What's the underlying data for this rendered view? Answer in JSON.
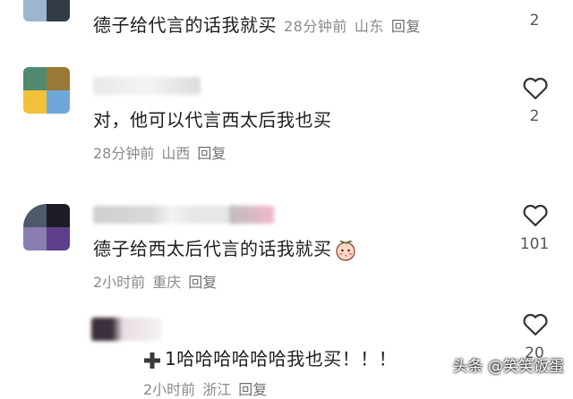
{
  "comments": [
    {
      "text": "德子给代言的话我就买",
      "time": "28分钟前",
      "location": "山东",
      "reply": "回复",
      "likes": "2",
      "avatar_colors": [
        "#7a9fc0",
        "#2a3240",
        "#9bb6cf",
        "#333b48"
      ]
    },
    {
      "text": "对，他可以代言西太后我也买",
      "time": "28分钟前",
      "location": "山西",
      "reply": "回复",
      "likes": "2",
      "avatar_colors": [
        "#4f8a6e",
        "#9a7a36",
        "#f1c13a",
        "#6fa8d8"
      ]
    },
    {
      "text": "德子给西太后代言的话我就买",
      "time": "2小时前",
      "location": "重庆",
      "reply": "回复",
      "likes": "101",
      "avatar_colors": [
        "#4e5a6a",
        "#1c1c24",
        "#8a7db0",
        "#5e3f8e"
      ]
    },
    {
      "text": "1哈哈哈哈哈哈我也买！！！",
      "time": "2小时前",
      "location": "浙江",
      "reply": "回复",
      "likes": "20",
      "avatar_colors": [
        "#3a2f3a",
        "#e6d6de",
        "#ffffff",
        "#ffffff"
      ]
    }
  ],
  "watermark": "头条 @笑笑饭蛋",
  "icons": {
    "like": "heart-outline-icon",
    "emoji": "peach-face-emoji-icon",
    "plus": "plus-icon"
  }
}
